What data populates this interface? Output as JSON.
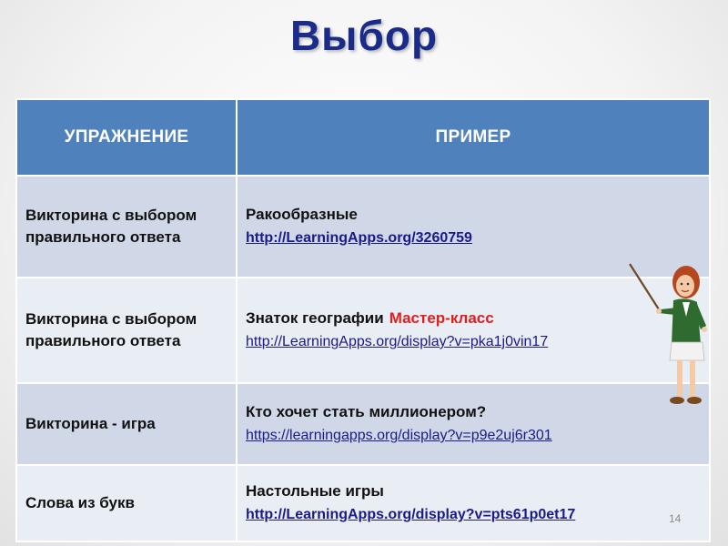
{
  "slide": {
    "title": "Выбор",
    "page_number": "14"
  },
  "table": {
    "headers": [
      "УПРАЖНЕНИЕ",
      "ПРИМЕР"
    ],
    "rows": [
      {
        "exercise": "Викторина с выбором правильного ответа",
        "example_name": "Ракообразные",
        "example_accent": "",
        "link": "http://LearningApps.org/3260759"
      },
      {
        "exercise": "Викторина с выбором правильного ответа",
        "example_name": "Знаток географии",
        "example_accent": "Мастер-класс",
        "link": "http://LearningApps.org/display?v=pka1j0vin17"
      },
      {
        "exercise": "Викторина - игра",
        "example_name": "Кто хочет стать миллионером?",
        "example_accent": "",
        "link": "https://learningapps.org/display?v=p9e2uj6r301"
      },
      {
        "exercise": "Слова из букв",
        "example_name": "Настольные игры",
        "example_accent": "",
        "link": "http://LearningApps.org/display?v=pts61p0et17"
      }
    ]
  },
  "colors": {
    "title": "#1a2b8a",
    "header_bg": "#4f81bd",
    "row_dark": "#d0d8e8",
    "row_light": "#e9edf4",
    "accent": "#e02020",
    "link": "#1a1a8a"
  },
  "icons": {
    "teacher": "teacher-with-pointer-icon"
  }
}
